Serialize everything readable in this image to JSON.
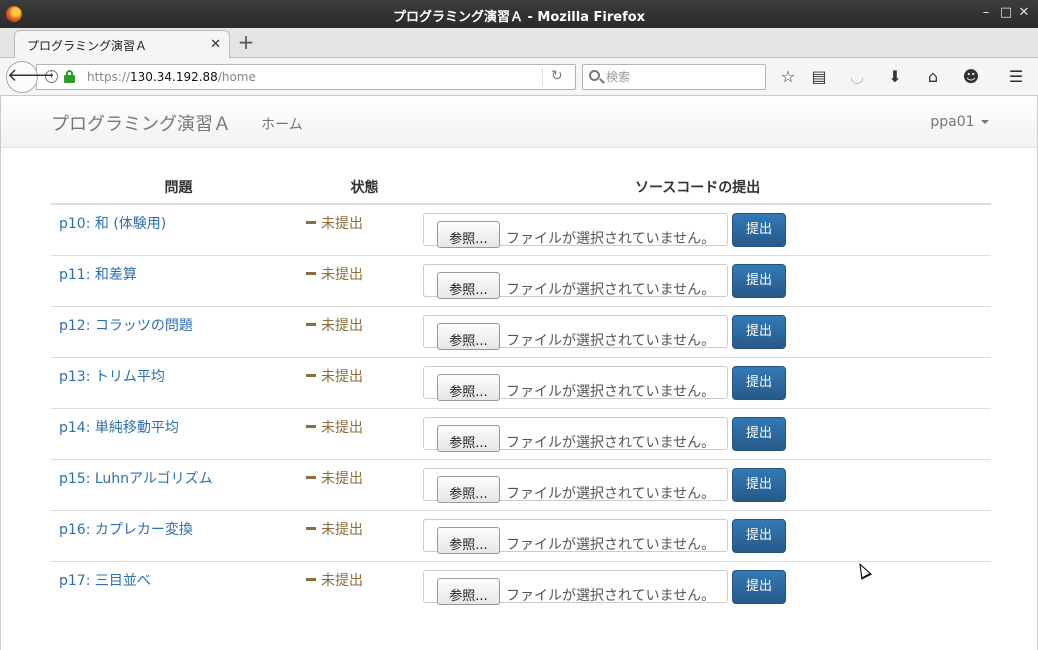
{
  "window": {
    "title": "プログラミング演習Ａ - Mozilla Firefox",
    "minimize": "–",
    "maximize": "□",
    "close": "✕"
  },
  "browser": {
    "tab_title": "プログラミング演習Ａ",
    "tab_close": "✕",
    "new_tab": "+",
    "url_scheme": "https://",
    "url_host": "130.34.192.88",
    "url_path": "/home",
    "search_placeholder": "検索",
    "icons": [
      "back-icon",
      "info-icon",
      "lock-icon",
      "reload-icon",
      "search-icon",
      "bookmark-star-icon",
      "reading-list-icon",
      "pocket-icon",
      "download-icon",
      "home-icon",
      "chat-icon",
      "menu-icon"
    ]
  },
  "app": {
    "brand": "プログラミング演習Ａ",
    "nav_home": "ホーム",
    "user": "ppa01"
  },
  "table": {
    "headers": [
      "問題",
      "状態",
      "ソースコードの提出"
    ],
    "rows": [
      {
        "problem": "p10: 和 (体験用)",
        "status": "未提出",
        "browse": "参照...",
        "file": "ファイルが選択されていません。",
        "submit": "提出"
      },
      {
        "problem": "p11: 和差算",
        "status": "未提出",
        "browse": "参照...",
        "file": "ファイルが選択されていません。",
        "submit": "提出"
      },
      {
        "problem": "p12: コラッツの問題",
        "status": "未提出",
        "browse": "参照...",
        "file": "ファイルが選択されていません。",
        "submit": "提出"
      },
      {
        "problem": "p13: トリム平均",
        "status": "未提出",
        "browse": "参照...",
        "file": "ファイルが選択されていません。",
        "submit": "提出"
      },
      {
        "problem": "p14: 単純移動平均",
        "status": "未提出",
        "browse": "参照...",
        "file": "ファイルが選択されていません。",
        "submit": "提出"
      },
      {
        "problem": "p15: Luhnアルゴリズム",
        "status": "未提出",
        "browse": "参照...",
        "file": "ファイルが選択されていません。",
        "submit": "提出"
      },
      {
        "problem": "p16: カプレカー変換",
        "status": "未提出",
        "browse": "参照...",
        "file": "ファイルが選択されていません。",
        "submit": "提出"
      },
      {
        "problem": "p17: 三目並べ",
        "status": "未提出",
        "browse": "参照...",
        "file": "ファイルが選択されていません。",
        "submit": "提出"
      }
    ]
  },
  "colors": {
    "link": "#2c6fb0",
    "status_warning": "#8a6d3b",
    "primary_button": "#337ab7"
  }
}
